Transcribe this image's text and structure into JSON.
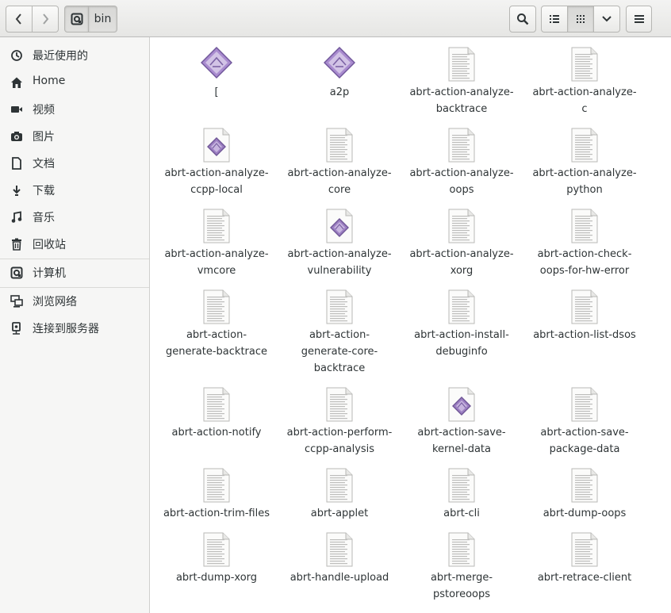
{
  "toolbar": {
    "back_label": "Back",
    "forward_label": "Forward",
    "location": "bin"
  },
  "sidebar": {
    "items": [
      {
        "label": "最近使用的",
        "icon": "recent-icon"
      },
      {
        "label": "Home",
        "icon": "home-icon"
      },
      {
        "label": "视频",
        "icon": "video-icon"
      },
      {
        "label": "图片",
        "icon": "camera-icon"
      },
      {
        "label": "文档",
        "icon": "document-icon"
      },
      {
        "label": "下载",
        "icon": "download-icon"
      },
      {
        "label": "音乐",
        "icon": "music-icon"
      },
      {
        "label": "回收站",
        "icon": "trash-icon"
      },
      {
        "label": "计算机",
        "icon": "computer-icon"
      },
      {
        "label": "浏览网络",
        "icon": "network-icon"
      },
      {
        "label": "连接到服务器",
        "icon": "server-icon"
      }
    ]
  },
  "files": [
    {
      "name": "[",
      "icon": "executable-icon"
    },
    {
      "name": "a2p",
      "icon": "executable-icon"
    },
    {
      "name": "abrt-action-analyze-\nbacktrace",
      "icon": "text-file-icon"
    },
    {
      "name": "abrt-action-analyze-\nc",
      "icon": "text-file-icon"
    },
    {
      "name": "abrt-action-analyze-\nccpp-local",
      "icon": "script-file-icon"
    },
    {
      "name": "abrt-action-analyze-\ncore",
      "icon": "text-file-icon"
    },
    {
      "name": "abrt-action-analyze-\noops",
      "icon": "text-file-icon"
    },
    {
      "name": "abrt-action-analyze-\npython",
      "icon": "text-file-icon"
    },
    {
      "name": "abrt-action-analyze-\nvmcore",
      "icon": "text-file-icon"
    },
    {
      "name": "abrt-action-analyze-\nvulnerability",
      "icon": "script-file-icon"
    },
    {
      "name": "abrt-action-analyze-\nxorg",
      "icon": "text-file-icon"
    },
    {
      "name": "abrt-action-check-\noops-for-hw-error",
      "icon": "text-file-icon"
    },
    {
      "name": "abrt-action-\ngenerate-backtrace",
      "icon": "text-file-icon"
    },
    {
      "name": "abrt-action-\ngenerate-core-\nbacktrace",
      "icon": "text-file-icon"
    },
    {
      "name": "abrt-action-install-\ndebuginfo",
      "icon": "text-file-icon"
    },
    {
      "name": "abrt-action-list-dsos",
      "icon": "text-file-icon"
    },
    {
      "name": "abrt-action-notify",
      "icon": "text-file-icon"
    },
    {
      "name": "abrt-action-perform-\nccpp-analysis",
      "icon": "text-file-icon"
    },
    {
      "name": "abrt-action-save-\nkernel-data",
      "icon": "script-file-icon"
    },
    {
      "name": "abrt-action-save-\npackage-data",
      "icon": "text-file-icon"
    },
    {
      "name": "abrt-action-trim-files",
      "icon": "text-file-icon"
    },
    {
      "name": "abrt-applet",
      "icon": "text-file-icon"
    },
    {
      "name": "abrt-cli",
      "icon": "text-file-icon"
    },
    {
      "name": "abrt-dump-oops",
      "icon": "text-file-icon"
    },
    {
      "name": "abrt-dump-xorg",
      "icon": "text-file-icon"
    },
    {
      "name": "abrt-handle-upload",
      "icon": "text-file-icon"
    },
    {
      "name": "abrt-merge-\npstoreoops",
      "icon": "text-file-icon"
    },
    {
      "name": "abrt-retrace-client",
      "icon": "text-file-icon"
    }
  ]
}
